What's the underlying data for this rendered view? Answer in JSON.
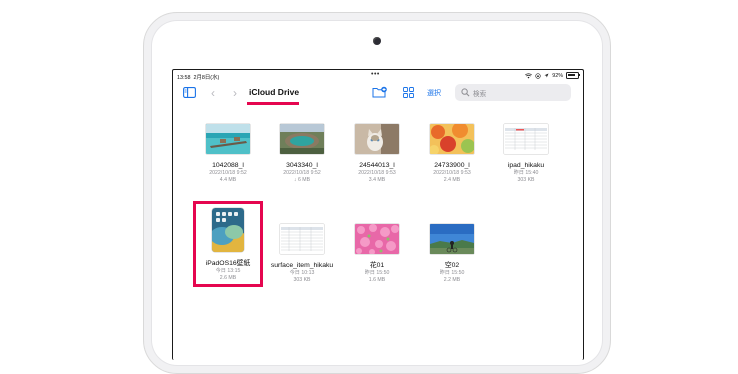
{
  "status_bar": {
    "time": "13:58",
    "date": "2月8日(水)",
    "dots": "•••",
    "battery_percent": "92%"
  },
  "toolbar": {
    "title": "iCloud Drive",
    "select_label": "選択",
    "search_placeholder": "検索"
  },
  "files": [
    {
      "name": "1042088_l",
      "date": "2022/10/18 9:52",
      "size": "4.4 MB",
      "thumb": "lagoon"
    },
    {
      "name": "3043340_l",
      "date": "2022/10/18 9:52",
      "size": "↓ 6 MB",
      "thumb": "crater"
    },
    {
      "name": "24544013_l",
      "date": "2022/10/18 9:53",
      "size": "3.4 MB",
      "thumb": "cat"
    },
    {
      "name": "24733900_l",
      "date": "2022/10/18 9:53",
      "size": "2.4 MB",
      "thumb": "autumn"
    },
    {
      "name": "ipad_hikaku",
      "date": "昨日 15:40",
      "size": "303 KB",
      "thumb": "table"
    },
    {
      "name": "iPadOS16壁紙",
      "date": "今日 13:15",
      "size": "2.6 MB",
      "thumb": "ipad"
    },
    {
      "name": "surface_item_hikaku",
      "date": "今日 10:13",
      "size": "303 KB",
      "thumb": "table"
    },
    {
      "name": "花01",
      "date": "昨日 15:50",
      "size": "1.6 MB",
      "thumb": "flowers"
    },
    {
      "name": "空02",
      "date": "昨日 15:50",
      "size": "2.2 MB",
      "thumb": "sky"
    }
  ],
  "colors": {
    "accent": "#1a73e8",
    "highlight": "#e5064f"
  }
}
